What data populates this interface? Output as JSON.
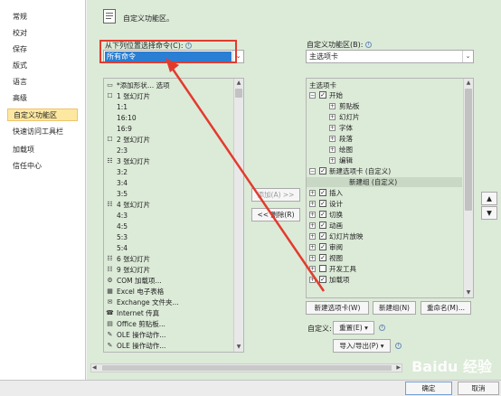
{
  "sidebar": {
    "items": [
      {
        "label": "常规"
      },
      {
        "label": "校对"
      },
      {
        "label": "保存"
      },
      {
        "label": "版式"
      },
      {
        "label": "语言"
      },
      {
        "label": "高级"
      },
      {
        "label": "自定义功能区"
      },
      {
        "label": "快速访问工具栏"
      },
      {
        "label": "加载项"
      },
      {
        "label": "信任中心"
      }
    ]
  },
  "header": {
    "title": "自定义功能区。"
  },
  "left": {
    "choose_label": "从下列位置选择命令(C):",
    "choose_value": "所有命令",
    "commands": [
      {
        "icon": "▭",
        "label": "*添加形状… 选项"
      },
      {
        "icon": "☐",
        "label": "1 张幻灯片"
      },
      {
        "icon": "",
        "label": "1:1"
      },
      {
        "icon": "",
        "label": "16:10"
      },
      {
        "icon": "",
        "label": "16:9"
      },
      {
        "icon": "☐",
        "label": "2 张幻灯片"
      },
      {
        "icon": "",
        "label": "2:3"
      },
      {
        "icon": "☷",
        "label": "3 张幻灯片"
      },
      {
        "icon": "",
        "label": "3:2"
      },
      {
        "icon": "",
        "label": "3:4"
      },
      {
        "icon": "",
        "label": "3:5"
      },
      {
        "icon": "☷",
        "label": "4 张幻灯片"
      },
      {
        "icon": "",
        "label": "4:3"
      },
      {
        "icon": "",
        "label": "4:5"
      },
      {
        "icon": "",
        "label": "5:3"
      },
      {
        "icon": "",
        "label": "5:4"
      },
      {
        "icon": "☷",
        "label": "6 张幻灯片"
      },
      {
        "icon": "☷",
        "label": "9 张幻灯片"
      },
      {
        "icon": "⚙",
        "label": "COM 加载项..."
      },
      {
        "icon": "▦",
        "label": "Excel 电子表格"
      },
      {
        "icon": "✉",
        "label": "Exchange 文件夹..."
      },
      {
        "icon": "☎",
        "label": "Internet 传真"
      },
      {
        "icon": "▤",
        "label": "Office 剪贴板..."
      },
      {
        "icon": "✎",
        "label": "OLE 操作动作..."
      },
      {
        "icon": "✎",
        "label": "OLE 操作动作..."
      }
    ]
  },
  "middle": {
    "add_label": "添加(A) >>",
    "remove_label": "<< 删除(R)"
  },
  "right": {
    "customize_label": "自定义功能区(B):",
    "customize_value": "主选项卡",
    "tree_header": "主选项卡",
    "tree": [
      {
        "indent": 0,
        "exp": "⊟",
        "checked": true,
        "label": "开始"
      },
      {
        "indent": 1,
        "exp": "⊞",
        "checked": null,
        "label": "剪贴板"
      },
      {
        "indent": 1,
        "exp": "⊞",
        "checked": null,
        "label": "幻灯片"
      },
      {
        "indent": 1,
        "exp": "⊞",
        "checked": null,
        "label": "字体"
      },
      {
        "indent": 1,
        "exp": "⊞",
        "checked": null,
        "label": "段落"
      },
      {
        "indent": 1,
        "exp": "⊞",
        "checked": null,
        "label": "绘图"
      },
      {
        "indent": 1,
        "exp": "⊞",
        "checked": null,
        "label": "编辑"
      },
      {
        "indent": 0,
        "exp": "⊟",
        "checked": true,
        "label": "新建选项卡 (自定义)"
      },
      {
        "indent": 2,
        "exp": "",
        "checked": null,
        "label": "新建组 (自定义)",
        "selected": true
      },
      {
        "indent": 0,
        "exp": "⊞",
        "checked": true,
        "label": "插入"
      },
      {
        "indent": 0,
        "exp": "⊞",
        "checked": true,
        "label": "设计"
      },
      {
        "indent": 0,
        "exp": "⊞",
        "checked": true,
        "label": "切换"
      },
      {
        "indent": 0,
        "exp": "⊞",
        "checked": true,
        "label": "动画"
      },
      {
        "indent": 0,
        "exp": "⊞",
        "checked": true,
        "label": "幻灯片放映"
      },
      {
        "indent": 0,
        "exp": "⊞",
        "checked": true,
        "label": "审阅"
      },
      {
        "indent": 0,
        "exp": "⊞",
        "checked": true,
        "label": "视图"
      },
      {
        "indent": 0,
        "exp": "⊞",
        "checked": false,
        "label": "开发工具"
      },
      {
        "indent": 0,
        "exp": "⊞",
        "checked": true,
        "label": "加载项"
      }
    ],
    "new_tab_label": "新建选项卡(W)",
    "new_group_label": "新建组(N)",
    "rename_label": "重命名(M)...",
    "customize_text": "自定义:",
    "reset_label": "重置(E) ▾",
    "import_export_label": "导入/导出(P) ▾"
  },
  "footer": {
    "ok_label": "确定",
    "cancel_label": "取消"
  },
  "watermark": "Baidu 经验",
  "colors": {
    "panel_bg": "#dcead8",
    "selected_nav": "#fde8a1",
    "annotation_red": "#e23b2e",
    "combo_selected": "#2a7fd4"
  }
}
